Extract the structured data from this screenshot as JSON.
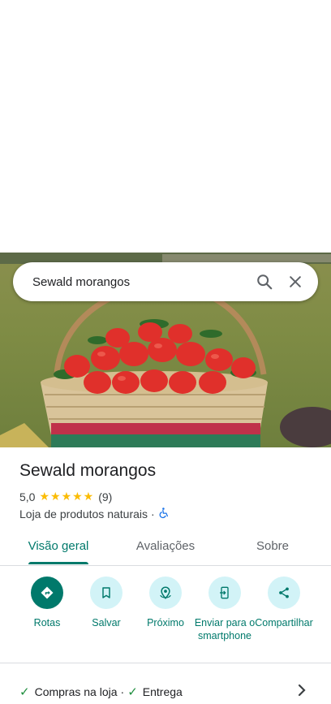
{
  "search": {
    "query": "Sewald morangos"
  },
  "place": {
    "name": "Sewald morangos",
    "rating": "5,0",
    "stars": "★★★★★",
    "review_count": "(9)",
    "category": "Loja de produtos naturais",
    "separator": "·"
  },
  "tabs": [
    {
      "label": "Visão geral",
      "active": true
    },
    {
      "label": "Avaliações",
      "active": false
    },
    {
      "label": "Sobre",
      "active": false
    }
  ],
  "actions": [
    {
      "label": "Rotas",
      "icon": "directions-icon"
    },
    {
      "label": "Salvar",
      "icon": "bookmark-icon"
    },
    {
      "label": "Próximo",
      "icon": "nearby-icon"
    },
    {
      "label": "Enviar para o smartphone",
      "icon": "send-to-phone-icon"
    },
    {
      "label": "Compartilhar",
      "icon": "share-icon"
    }
  ],
  "services": {
    "item1": "Compras na loja",
    "separator": "·",
    "item2": "Entrega"
  },
  "colors": {
    "accent": "#00796b",
    "action_bg": "#d2f3f7",
    "star": "#fbbc04",
    "check": "#1e8e3e"
  }
}
